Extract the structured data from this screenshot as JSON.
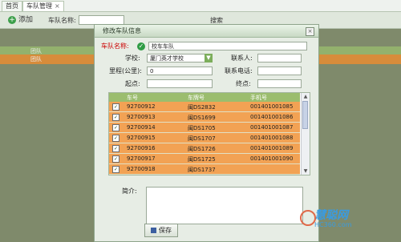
{
  "tabs": [
    {
      "label": "首页"
    },
    {
      "label": "车队管理"
    }
  ],
  "toolbar": {
    "add_label": "添加",
    "search_label": "车队名称:",
    "search_button": "搜索"
  },
  "background_rows": [
    {
      "label": "团队"
    },
    {
      "label": "团队"
    }
  ],
  "dialog": {
    "title": "修改车队信息",
    "close": "×",
    "form": {
      "team_name_label": "车队名称:",
      "team_name_value": "校车车队",
      "school_label": "学校:",
      "school_value": "厦门英才学校",
      "contact_label": "联系人:",
      "mileage_label": "里程(公里):",
      "mileage_value": "0",
      "phone_label": "联系电话:",
      "start_label": "起点:",
      "end_label": "终点:",
      "intro_label": "简介:",
      "save_label": "保存"
    },
    "table": {
      "columns": [
        "车号",
        "车牌号",
        "手机号"
      ],
      "rows": [
        {
          "car": "92700912",
          "plate": "闽DS2832",
          "phone": "001401001085"
        },
        {
          "car": "92700913",
          "plate": "闽DS1699",
          "phone": "001401001086"
        },
        {
          "car": "92700914",
          "plate": "闽DS1705",
          "phone": "001401001087"
        },
        {
          "car": "92700915",
          "plate": "闽DS1707",
          "phone": "001401001088"
        },
        {
          "car": "92700916",
          "plate": "闽DS1726",
          "phone": "001401001089"
        },
        {
          "car": "92700917",
          "plate": "闽DS1725",
          "phone": "001401001090"
        },
        {
          "car": "92700918",
          "plate": "闽DS1737",
          "phone": ""
        }
      ]
    }
  },
  "watermark": {
    "main": "慧聪网",
    "sub": "HC360.com"
  }
}
